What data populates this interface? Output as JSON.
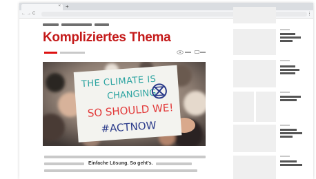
{
  "browser": {
    "tab_close": "×",
    "new_tab": "+",
    "back_icon": "←",
    "forward_icon": "→",
    "reload_icon": "C",
    "menu_icon": "⋮"
  },
  "article": {
    "title": "Kompliziertes Thema",
    "caption": "Einfache Lösung. So geht's."
  },
  "hero_sign": {
    "line1": "THE CLIMATE IS",
    "line2": "CHANGING",
    "line3": "SO SHOULD WE!",
    "line4": "#ACTNOW"
  },
  "colors": {
    "title_red": "#c41a1a",
    "accent_red": "#dd1111",
    "sign_teal": "#2aa3a0",
    "sign_red": "#e23a3a",
    "sign_blue": "#2a3a8a"
  }
}
